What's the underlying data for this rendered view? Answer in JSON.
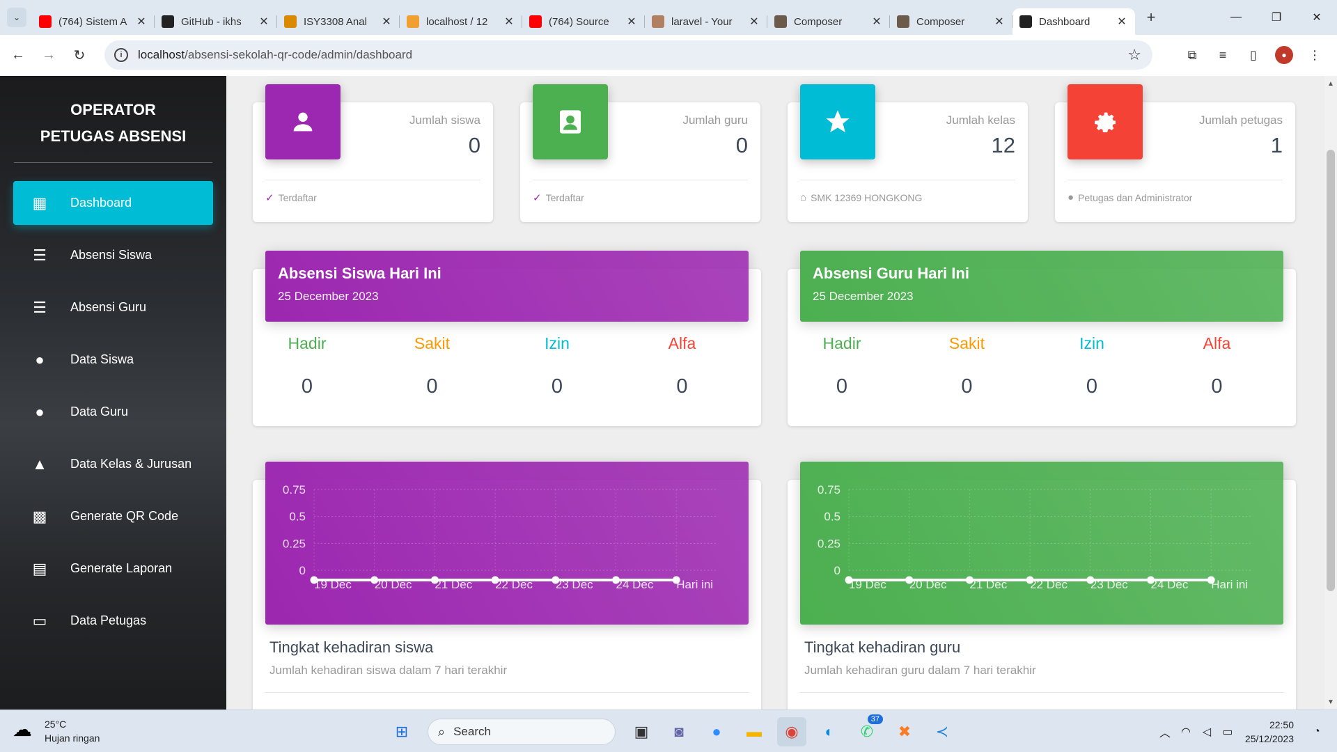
{
  "browser": {
    "tabs": [
      {
        "title": "(764) Sistem A",
        "favicon": "youtube-icon",
        "color": "#ff0000"
      },
      {
        "title": "GitHub - ikhs",
        "favicon": "github-icon",
        "color": "#222222"
      },
      {
        "title": "ISY3308 Anal",
        "favicon": "moodle-icon",
        "color": "#d98a00"
      },
      {
        "title": "localhost / 12",
        "favicon": "phpmyadmin-icon",
        "color": "#f0a030"
      },
      {
        "title": "(764) Source",
        "favicon": "youtube-icon",
        "color": "#ff0000"
      },
      {
        "title": "laravel - Your",
        "favicon": "laravel-icon",
        "color": "#b08060"
      },
      {
        "title": "Composer",
        "favicon": "composer-icon",
        "color": "#6c5a4a"
      },
      {
        "title": "Composer",
        "favicon": "composer-icon",
        "color": "#6c5a4a"
      },
      {
        "title": "Dashboard",
        "favicon": "qr-icon",
        "color": "#222222",
        "active": true
      }
    ],
    "url_host": "localhost",
    "url_path": "/absensi-sekolah-qr-code/admin/dashboard"
  },
  "sidebar": {
    "brand_line1": "OPERATOR",
    "brand_line2": "PETUGAS ABSENSI",
    "items": [
      {
        "label": "Dashboard",
        "icon": "dashboard-icon",
        "active": true
      },
      {
        "label": "Absensi Siswa",
        "icon": "checklist-icon"
      },
      {
        "label": "Absensi Guru",
        "icon": "checklist-icon"
      },
      {
        "label": "Data Siswa",
        "icon": "person-icon"
      },
      {
        "label": "Data Guru",
        "icon": "person-icon"
      },
      {
        "label": "Data Kelas & Jurusan",
        "icon": "school-icon"
      },
      {
        "label": "Generate QR Code",
        "icon": "qr-code-icon"
      },
      {
        "label": "Generate Laporan",
        "icon": "print-icon"
      },
      {
        "label": "Data Petugas",
        "icon": "laptop-icon"
      }
    ]
  },
  "stats": [
    {
      "label": "Jumlah siswa",
      "value": "0",
      "footer": "Terdaftar",
      "footer_icon": "check-icon",
      "color": "#9c27b0",
      "icon": "person-icon"
    },
    {
      "label": "Jumlah guru",
      "value": "0",
      "footer": "Terdaftar",
      "footer_icon": "check-icon",
      "color": "#4caf50",
      "icon": "person-badge-icon"
    },
    {
      "label": "Jumlah kelas",
      "value": "12",
      "footer": "SMK 12369 HONGKONG",
      "footer_icon": "home-icon",
      "color": "#00bcd4",
      "icon": "star-icon"
    },
    {
      "label": "Jumlah petugas",
      "value": "1",
      "footer": "Petugas dan Administrator",
      "footer_icon": "person-icon",
      "color": "#f44336",
      "icon": "gear-icon"
    }
  ],
  "attendance": [
    {
      "title": "Absensi Siswa Hari Ini",
      "date": "25 December 2023",
      "color": "#9c27b0",
      "columns": [
        {
          "label": "Hadir",
          "value": "0",
          "color": "#4caf50"
        },
        {
          "label": "Sakit",
          "value": "0",
          "color": "#ff9800"
        },
        {
          "label": "Izin",
          "value": "0",
          "color": "#00bcd4"
        },
        {
          "label": "Alfa",
          "value": "0",
          "color": "#f44336"
        }
      ]
    },
    {
      "title": "Absensi Guru Hari Ini",
      "date": "25 December 2023",
      "color": "#4caf50",
      "columns": [
        {
          "label": "Hadir",
          "value": "0",
          "color": "#4caf50"
        },
        {
          "label": "Sakit",
          "value": "0",
          "color": "#ff9800"
        },
        {
          "label": "Izin",
          "value": "0",
          "color": "#00bcd4"
        },
        {
          "label": "Alfa",
          "value": "0",
          "color": "#f44336"
        }
      ]
    }
  ],
  "charts": [
    {
      "title": "Tingkat kehadiran siswa",
      "subtitle": "Jumlah kehadiran siswa dalam 7 hari terakhir",
      "color": "#9c27b0"
    },
    {
      "title": "Tingkat kehadiran guru",
      "subtitle": "Jumlah kehadiran guru dalam 7 hari terakhir",
      "color": "#4caf50"
    }
  ],
  "chart_data": [
    {
      "type": "line",
      "categories": [
        "19 Dec",
        "20 Dec",
        "21 Dec",
        "22 Dec",
        "23 Dec",
        "24 Dec",
        "Hari ini"
      ],
      "values": [
        0,
        0,
        0,
        0,
        0,
        0,
        0
      ],
      "y_ticks": [
        "0.75",
        "0.5",
        "0.25",
        "0"
      ],
      "ylim": [
        0,
        0.75
      ],
      "grid": true
    },
    {
      "type": "line",
      "categories": [
        "19 Dec",
        "20 Dec",
        "21 Dec",
        "22 Dec",
        "23 Dec",
        "24 Dec",
        "Hari ini"
      ],
      "values": [
        0,
        0,
        0,
        0,
        0,
        0,
        0
      ],
      "y_ticks": [
        "0.75",
        "0.5",
        "0.25",
        "0"
      ],
      "ylim": [
        0,
        0.75
      ],
      "grid": true
    }
  ],
  "taskbar": {
    "weather_temp": "25°C",
    "weather_desc": "Hujan ringan",
    "search_label": "Search",
    "whatsapp_badge": "37",
    "time": "22:50",
    "date": "25/12/2023"
  }
}
